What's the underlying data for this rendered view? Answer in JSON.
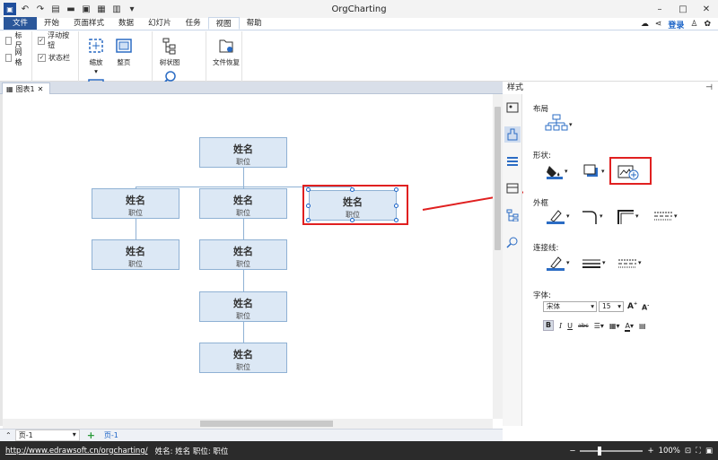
{
  "window": {
    "title": "OrgCharting"
  },
  "menu": {
    "file": "文件",
    "items": [
      "开始",
      "页面样式",
      "数据",
      "幻灯片",
      "任务",
      "视图",
      "帮助"
    ],
    "active": "视图",
    "login": "登录"
  },
  "ribbon": {
    "checks": [
      {
        "label": "标尺",
        "checked": false
      },
      {
        "label": "网格",
        "checked": false
      },
      {
        "label": "浮动按钮",
        "checked": true
      },
      {
        "label": "状态栏",
        "checked": true
      }
    ],
    "buttons": [
      "缩放",
      "整页",
      "页宽",
      "树状图",
      "搜索",
      "文件恢复"
    ]
  },
  "doc_tab": {
    "label": "图表1"
  },
  "chart": {
    "nodes": [
      {
        "name": "姓名",
        "position": "职位"
      },
      {
        "name": "姓名",
        "position": "职位"
      },
      {
        "name": "姓名",
        "position": "职位"
      },
      {
        "name": "姓名",
        "position": "职位"
      },
      {
        "name": "姓名",
        "position": "职位"
      },
      {
        "name": "姓名",
        "position": "职位"
      },
      {
        "name": "姓名",
        "position": "职位"
      },
      {
        "name": "姓名",
        "position": "职位"
      }
    ]
  },
  "panel": {
    "title": "样式",
    "sections": {
      "layout": "布局",
      "shape": "形状:",
      "border": "外框",
      "connector": "连接线:",
      "font": "字体:"
    },
    "font_name": "宋体",
    "font_size": "15",
    "format_buttons": [
      "B",
      "I",
      "U",
      "abc"
    ]
  },
  "pagebar": {
    "page_select": "页-1",
    "page_tab": "页-1"
  },
  "status": {
    "url": "http://www.edrawsoft.cn/orgcharting/",
    "text": "姓名: 姓名  职位: 职位",
    "zoom": "100%"
  },
  "colors": {
    "accent": "#2b579a",
    "node_fill": "#dce8f5",
    "node_border": "#8fb1d4",
    "highlight": "#e02020"
  }
}
